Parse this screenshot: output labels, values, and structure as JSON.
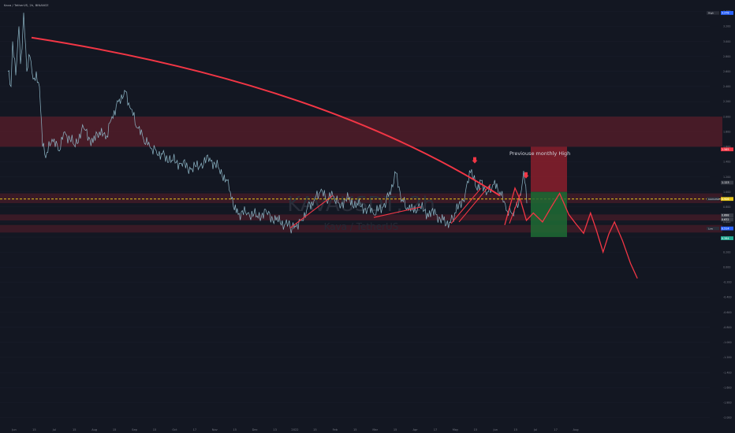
{
  "header": {
    "title": "Kava / TetherUS, 2h, BINANCE"
  },
  "watermark": {
    "symbol": "KAVAUSDT, 2h",
    "subtitle": "Kava / TetherUS"
  },
  "colors": {
    "background": "#131722",
    "candles": "#8fb8c8",
    "curve": "#f23645",
    "zone": "#5a1d2a",
    "current_price_line": "#e6c619",
    "stop_box": "#8a1e2c",
    "target_box": "#1e6b34",
    "forecast": "#f23645",
    "axis_text": "#787b86",
    "grid": "#1e2230"
  },
  "chart_data": {
    "type": "line",
    "title": "KAVAUSDT, 2h",
    "x_ticks": [
      "Jun",
      "15",
      "Jul",
      "15",
      "Aug",
      "15",
      "Sep",
      "15",
      "Oct",
      "17",
      "Nov",
      "15",
      "Dec",
      "13",
      "2022",
      "15",
      "Feb",
      "15",
      "Mar",
      "15",
      "Apr",
      "17",
      "May",
      "15",
      "Jun",
      "15",
      "Jul",
      "17",
      "Aug"
    ],
    "y_ticks": [
      "3.400",
      "3.200",
      "3.000",
      "2.800",
      "2.600",
      "2.400",
      "2.200",
      "2.000",
      "1.800",
      "1.600",
      "1.400",
      "1.200",
      "1.000",
      "0.800",
      "0.600",
      "0.400",
      "0.200",
      "0.000",
      "-0.200",
      "-0.400",
      "-0.600",
      "-0.800",
      "-1.000",
      "-1.200",
      "-1.400",
      "-1.600",
      "-1.800",
      "-2.000"
    ],
    "ylim": [
      -2.1,
      3.55
    ],
    "price_path": {
      "name": "KAVAUSDT",
      "points": [
        [
          0,
          2.6
        ],
        [
          2,
          2.4
        ],
        [
          3,
          3.0
        ],
        [
          5,
          2.55
        ],
        [
          7,
          3.2
        ],
        [
          8,
          2.7
        ],
        [
          9,
          2.9
        ],
        [
          10,
          3.38
        ],
        [
          12,
          2.6
        ],
        [
          14,
          2.8
        ],
        [
          16,
          2.5
        ],
        [
          18,
          2.6
        ],
        [
          20,
          2.4
        ],
        [
          22,
          1.6
        ],
        [
          24,
          1.45
        ],
        [
          28,
          1.7
        ],
        [
          32,
          1.55
        ],
        [
          36,
          1.8
        ],
        [
          42,
          1.62
        ],
        [
          48,
          1.85
        ],
        [
          54,
          1.65
        ],
        [
          58,
          1.8
        ],
        [
          62,
          1.7
        ],
        [
          66,
          2.0
        ],
        [
          70,
          2.2
        ],
        [
          74,
          2.35
        ],
        [
          78,
          2.1
        ],
        [
          82,
          1.85
        ],
        [
          86,
          1.7
        ],
        [
          90,
          1.6
        ],
        [
          94,
          1.55
        ],
        [
          98,
          1.5
        ],
        [
          104,
          1.42
        ],
        [
          110,
          1.38
        ],
        [
          116,
          1.3
        ],
        [
          122,
          1.35
        ],
        [
          128,
          1.45
        ],
        [
          134,
          1.3
        ],
        [
          139,
          1.15
        ],
        [
          141,
          1.0
        ],
        [
          143,
          0.8
        ],
        [
          146,
          0.7
        ],
        [
          152,
          0.72
        ],
        [
          158,
          0.68
        ],
        [
          164,
          0.73
        ],
        [
          170,
          0.62
        ],
        [
          176,
          0.58
        ],
        [
          179,
          0.52
        ],
        [
          182,
          0.55
        ],
        [
          186,
          0.62
        ],
        [
          190,
          0.8
        ],
        [
          194,
          0.88
        ],
        [
          198,
          1.0
        ],
        [
          202,
          0.9
        ],
        [
          206,
          0.95
        ],
        [
          210,
          0.85
        ],
        [
          216,
          0.9
        ],
        [
          222,
          0.82
        ],
        [
          228,
          0.78
        ],
        [
          232,
          0.7
        ],
        [
          238,
          0.8
        ],
        [
          242,
          1.0
        ],
        [
          246,
          1.25
        ],
        [
          250,
          0.9
        ],
        [
          254,
          0.75
        ],
        [
          260,
          0.8
        ],
        [
          266,
          0.72
        ],
        [
          272,
          0.7
        ],
        [
          276,
          0.62
        ],
        [
          280,
          0.6
        ],
        [
          284,
          0.72
        ],
        [
          290,
          0.98
        ],
        [
          294,
          1.3
        ],
        [
          297,
          1.05
        ],
        [
          300,
          1.15
        ],
        [
          304,
          1.0
        ],
        [
          308,
          1.1
        ],
        [
          312,
          1.0
        ],
        [
          316,
          0.75
        ],
        [
          320,
          0.7
        ],
        [
          322,
          0.8
        ],
        [
          325,
          0.95
        ],
        [
          327,
          1.28
        ],
        [
          329,
          0.85
        ]
      ]
    },
    "annotations": [
      "Previouse monthly High"
    ],
    "price_labels": {
      "high": {
        "tag": "High",
        "value": "3.378"
      },
      "level_top": {
        "value": "1.565"
      },
      "level_mid": {
        "value": "1.123"
      },
      "current": {
        "tag": "KAVAUSDT",
        "value": "0.906"
      },
      "level_low1": {
        "value": "0.688"
      },
      "level_low2": {
        "value": "0.632"
      },
      "low": {
        "tag": "Low",
        "value": "0.514"
      },
      "target": {
        "value": "0.384"
      }
    },
    "zones": [
      {
        "from": 1.75,
        "to": 1.75
      },
      {
        "from": 1.6,
        "to": 2.0
      },
      {
        "from": 0.85,
        "to": 0.98
      },
      {
        "from": 0.62,
        "to": 0.7
      },
      {
        "from": 0.46,
        "to": 0.56
      }
    ],
    "position_box": {
      "entry": 1.0,
      "stop": 1.6,
      "target": 0.4
    },
    "current_price": 0.906,
    "forecast_points": [
      [
        0.0,
        0.56
      ],
      [
        0.4,
        0.78
      ],
      [
        0.9,
        1.05
      ],
      [
        1.4,
        0.88
      ],
      [
        1.9,
        0.62
      ],
      [
        2.5,
        0.72
      ],
      [
        3.3,
        0.6
      ],
      [
        4.0,
        0.78
      ],
      [
        4.8,
        0.98
      ],
      [
        5.6,
        0.7
      ],
      [
        6.2,
        0.58
      ],
      [
        6.9,
        0.45
      ],
      [
        7.5,
        0.72
      ],
      [
        8.0,
        0.5
      ],
      [
        8.6,
        0.2
      ],
      [
        9.1,
        0.44
      ],
      [
        9.6,
        0.6
      ],
      [
        10.3,
        0.35
      ],
      [
        11.0,
        0.05
      ],
      [
        11.6,
        -0.15
      ]
    ]
  }
}
